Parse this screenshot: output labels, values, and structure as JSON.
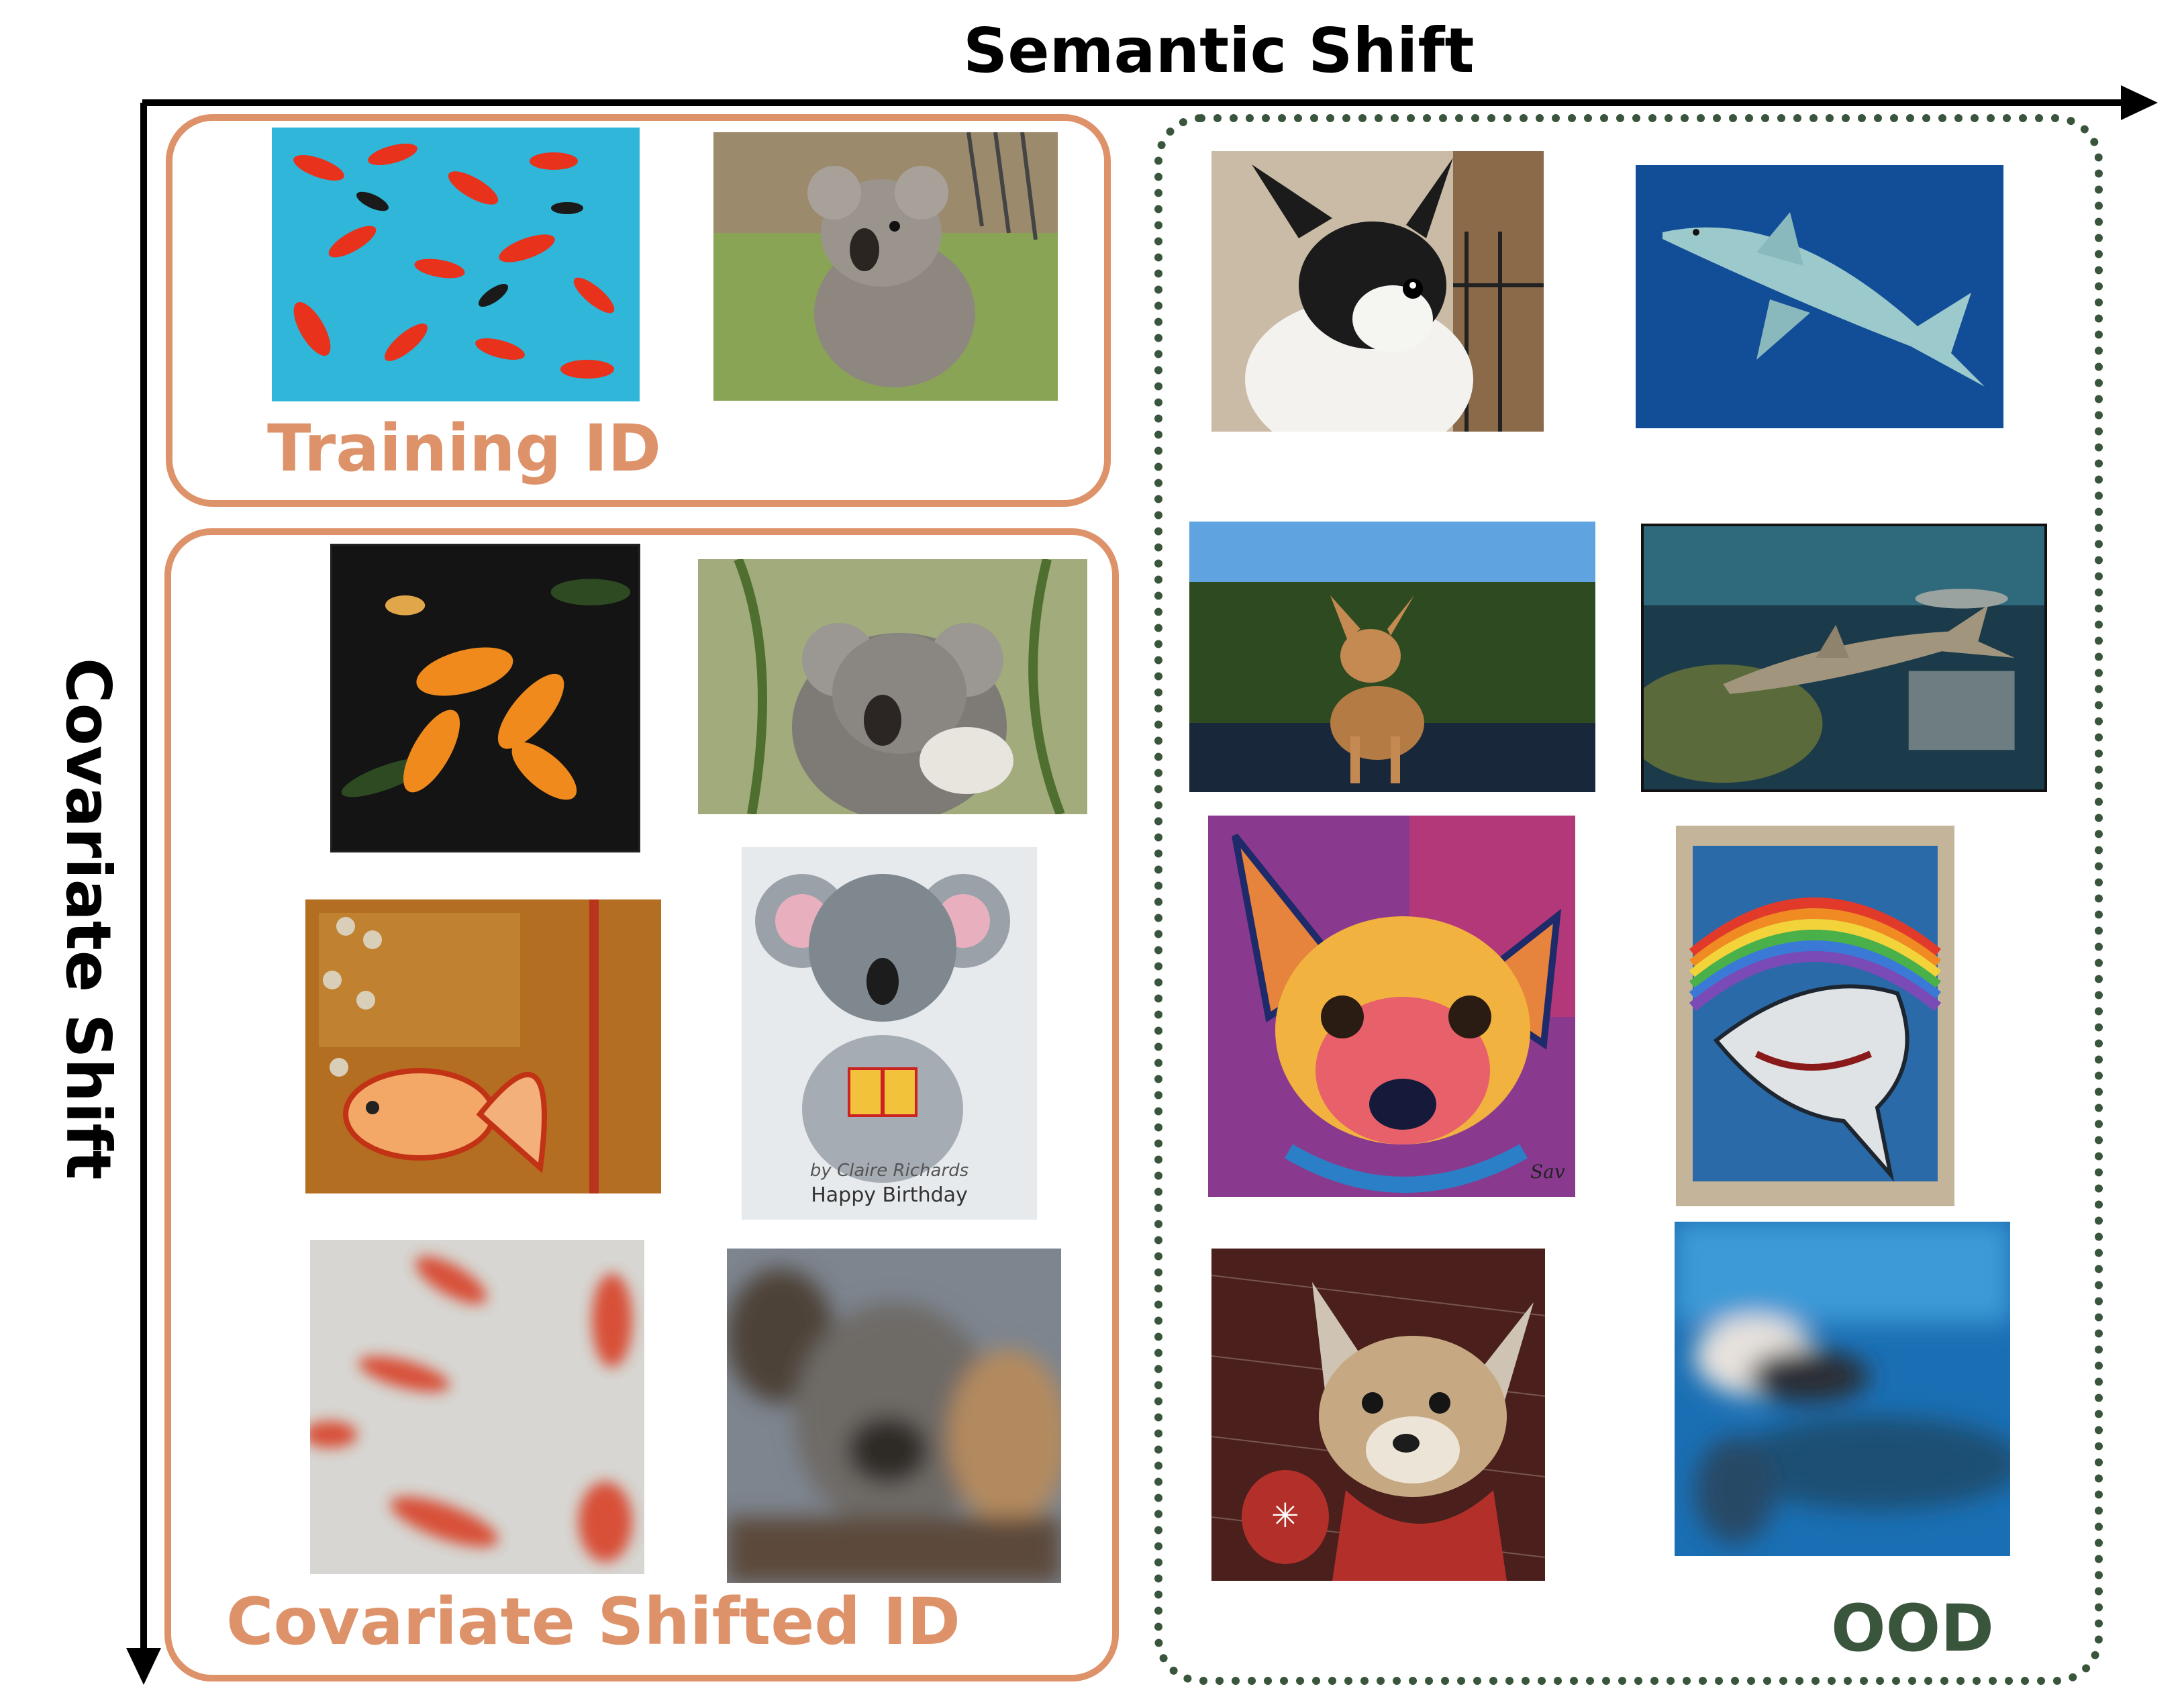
{
  "axes": {
    "x_title": "Semantic Shift",
    "y_title": "Covariate Shift",
    "color": "#000000"
  },
  "groups": {
    "training_id": {
      "label": "Training ID",
      "color": "#de926a"
    },
    "covariate_shifted_id": {
      "label": "Covariate Shifted ID",
      "color": "#de926a"
    },
    "ood": {
      "label": "OOD",
      "color": "#39553b"
    }
  },
  "images": [
    {
      "name": "goldfish-photo",
      "group": "training_id",
      "subject": "goldfish-icon"
    },
    {
      "name": "koala-photo",
      "group": "training_id",
      "subject": "koala-icon"
    },
    {
      "name": "goldfish-dark-photo",
      "group": "covariate_shifted_id",
      "subject": "goldfish-icon"
    },
    {
      "name": "koala-closeup-photo",
      "group": "covariate_shifted_id",
      "subject": "koala-icon"
    },
    {
      "name": "goldfish-painting",
      "group": "covariate_shifted_id",
      "subject": "goldfish-icon"
    },
    {
      "name": "koala-birthday-drawing",
      "group": "covariate_shifted_id",
      "subject": "koala-icon",
      "caption_lines": [
        "by Claire Richards",
        "Happy Birthday"
      ]
    },
    {
      "name": "goldfish-blurred-photo",
      "group": "covariate_shifted_id",
      "subject": "goldfish-icon"
    },
    {
      "name": "koala-blurred-photo",
      "group": "covariate_shifted_id",
      "subject": "koala-icon"
    },
    {
      "name": "chihuahua-photo",
      "group": "ood",
      "subject": "chihuahua-icon"
    },
    {
      "name": "shark-photo",
      "group": "ood",
      "subject": "shark-icon"
    },
    {
      "name": "chihuahua-outdoor-photo",
      "group": "ood",
      "subject": "chihuahua-icon"
    },
    {
      "name": "shark-aquarium-photo",
      "group": "ood",
      "subject": "shark-icon"
    },
    {
      "name": "chihuahua-painting",
      "group": "ood",
      "subject": "chihuahua-icon",
      "signature": "Sav"
    },
    {
      "name": "shark-rainbow-art",
      "group": "ood",
      "subject": "shark-icon"
    },
    {
      "name": "chihuahua-sketch",
      "group": "ood",
      "subject": "chihuahua-icon"
    },
    {
      "name": "shark-blurred-photo",
      "group": "ood",
      "subject": "shark-icon"
    }
  ]
}
